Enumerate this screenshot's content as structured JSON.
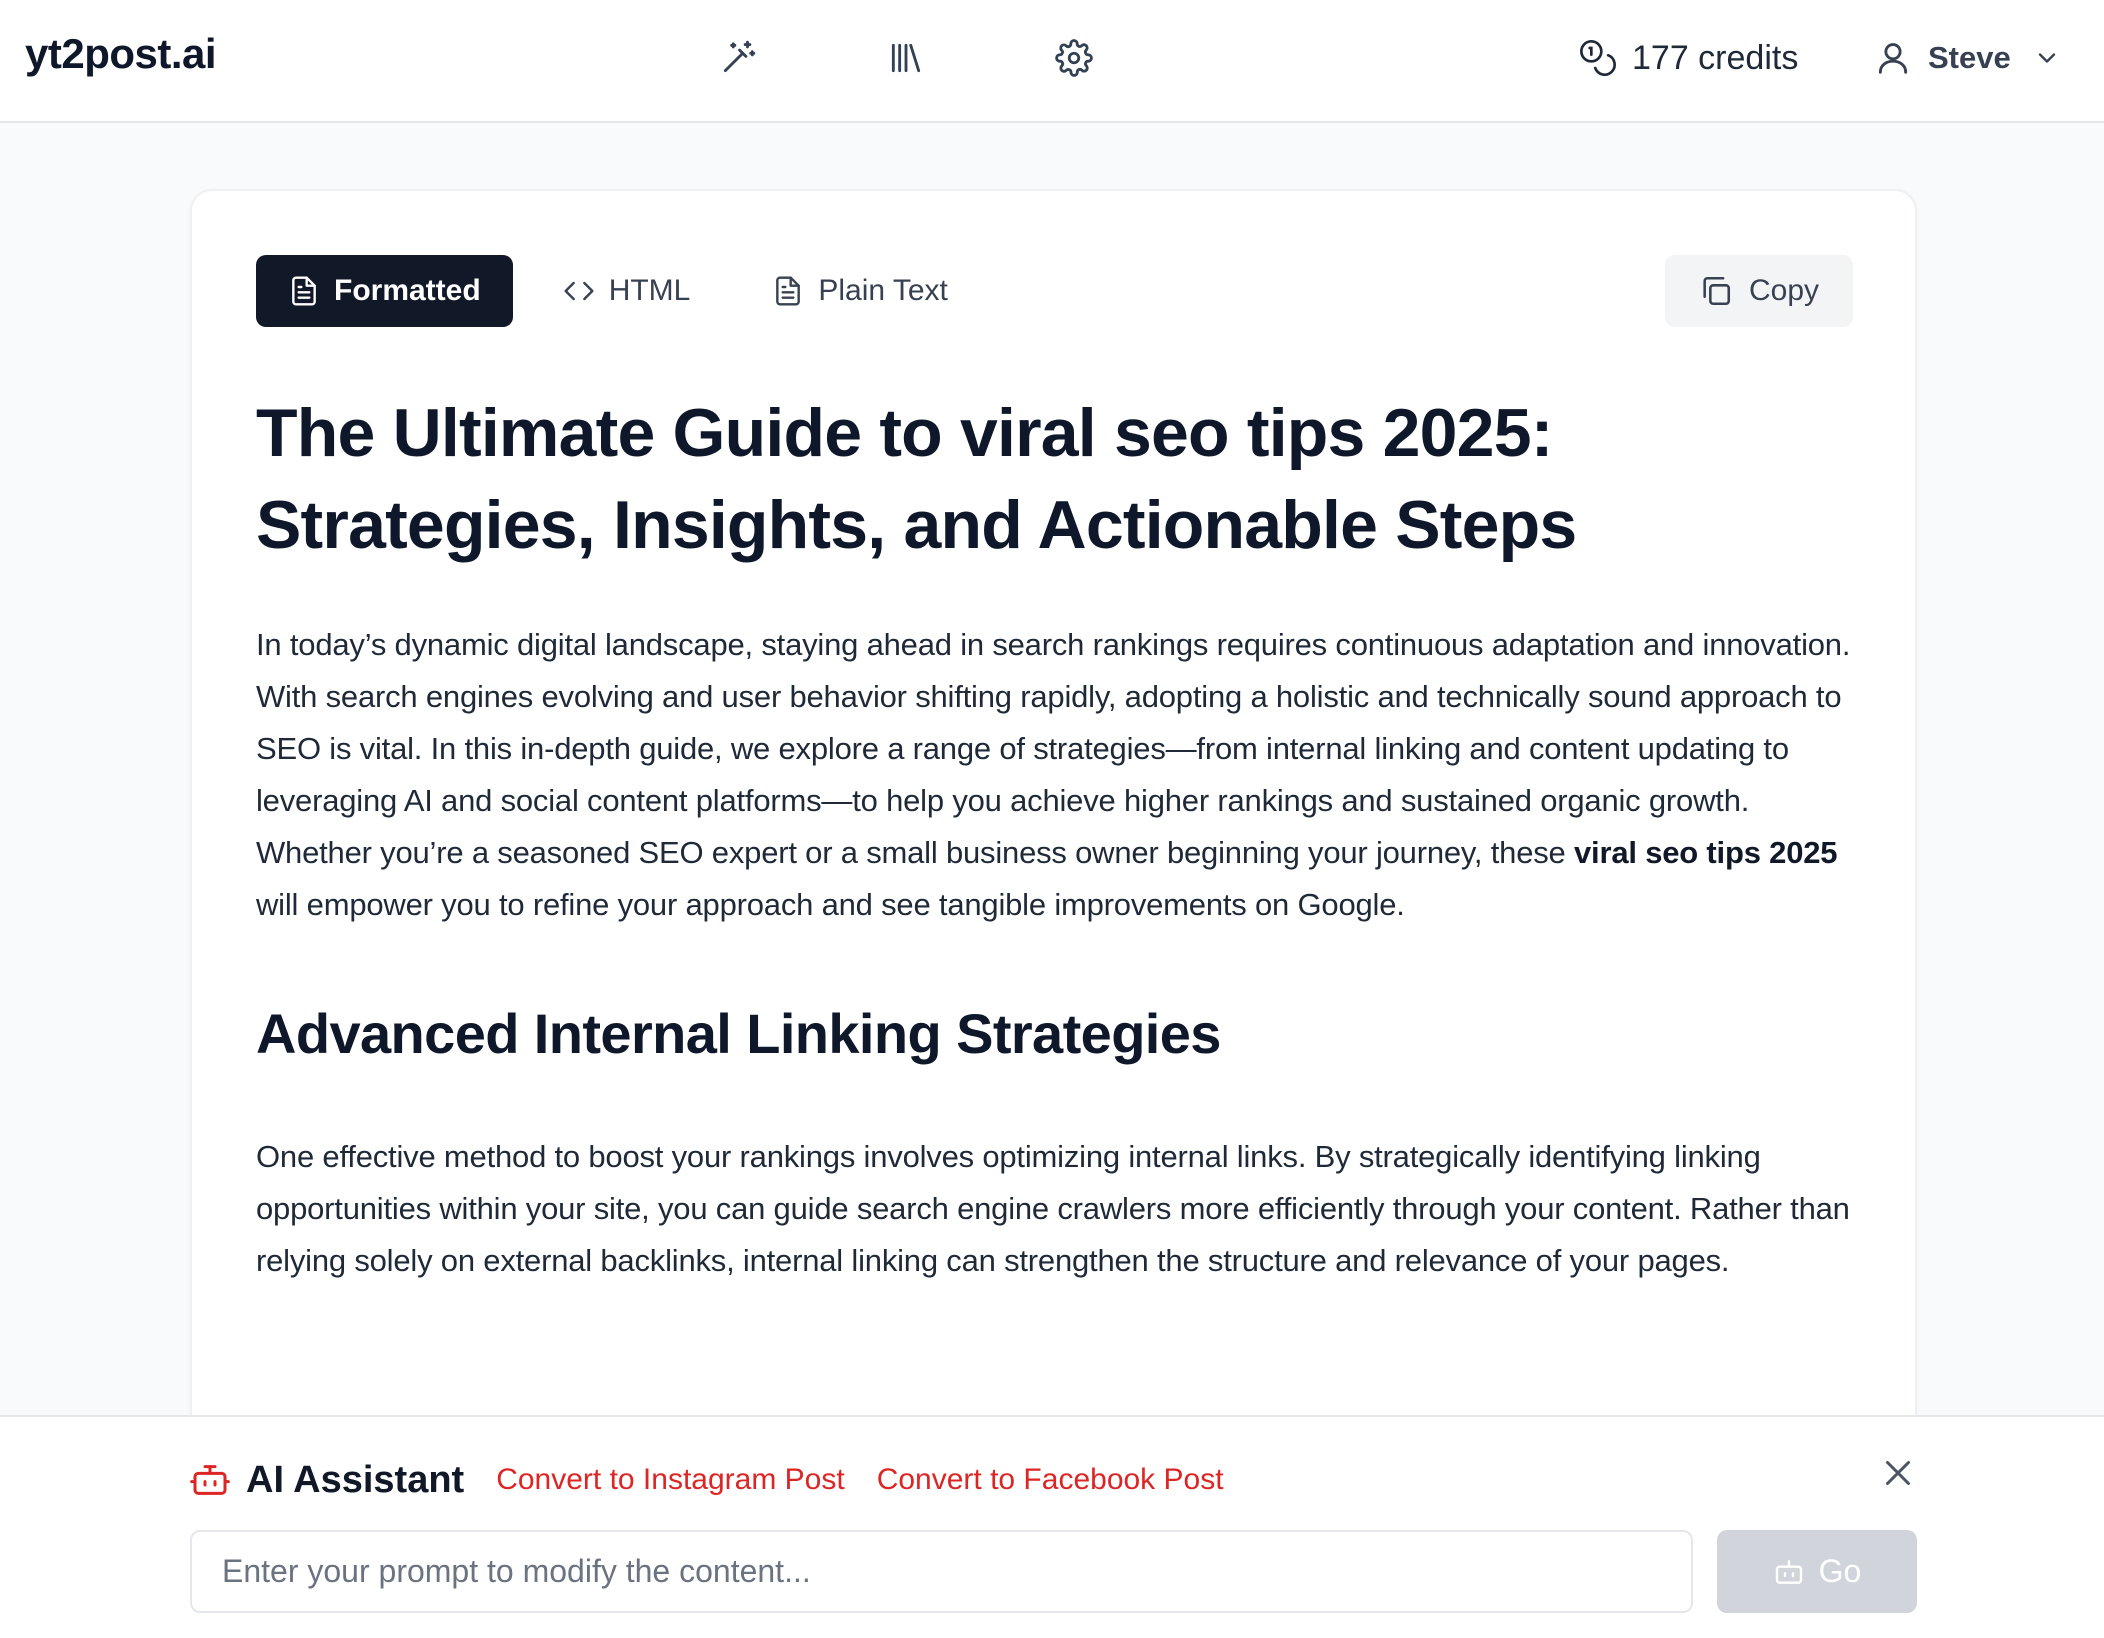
{
  "header": {
    "logo": "yt2post.ai",
    "nav_icons": [
      "magic-wand-icon",
      "library-icon",
      "settings-icon"
    ],
    "credits_icon": "coins-icon",
    "credits": "177 credits",
    "user_name": "Steve"
  },
  "tabs": [
    {
      "label": "Formatted",
      "icon": "document-icon",
      "active": true
    },
    {
      "label": "HTML",
      "icon": "code-icon",
      "active": false
    },
    {
      "label": "Plain Text",
      "icon": "text-file-icon",
      "active": false
    }
  ],
  "copy_label": "Copy",
  "article": {
    "title_line1": "The Ultimate Guide to viral seo tips 2025:",
    "title_line2": "Strategies, Insights, and Actionable Steps",
    "intro_before": "In today’s dynamic digital landscape, staying ahead in search rankings requires continuous adaptation and innovation. With search engines evolving and user behavior shifting rapidly, adopting a holistic and technically sound approach to SEO is vital. In this in-depth guide, we explore a range of strategies—from internal linking and content updating to leveraging AI and social content platforms—to help you achieve higher rankings and sustained organic growth. Whether you’re a seasoned SEO expert or a small business owner beginning your journey, these ",
    "intro_bold": "viral seo tips 2025",
    "intro_after": " will empower you to refine your approach and see tangible improvements on Google.",
    "section_heading": "Advanced Internal Linking Strategies",
    "section_para": "One effective method to boost your rankings involves optimizing internal links. By strategically identifying linking opportunities within your site, you can guide search engine crawlers more efficiently through your content. Rather than relying solely on external backlinks, internal linking can strengthen the structure and relevance of your pages."
  },
  "assistant": {
    "title": "AI Assistant",
    "actions": [
      "Convert to Instagram Post",
      "Convert to Facebook Post"
    ],
    "prompt_placeholder": "Enter your prompt to modify the content...",
    "go_label": "Go"
  },
  "colors": {
    "accent": "#dc2626",
    "active_tab": "#111827",
    "disabled_button": "#d1d5db"
  }
}
